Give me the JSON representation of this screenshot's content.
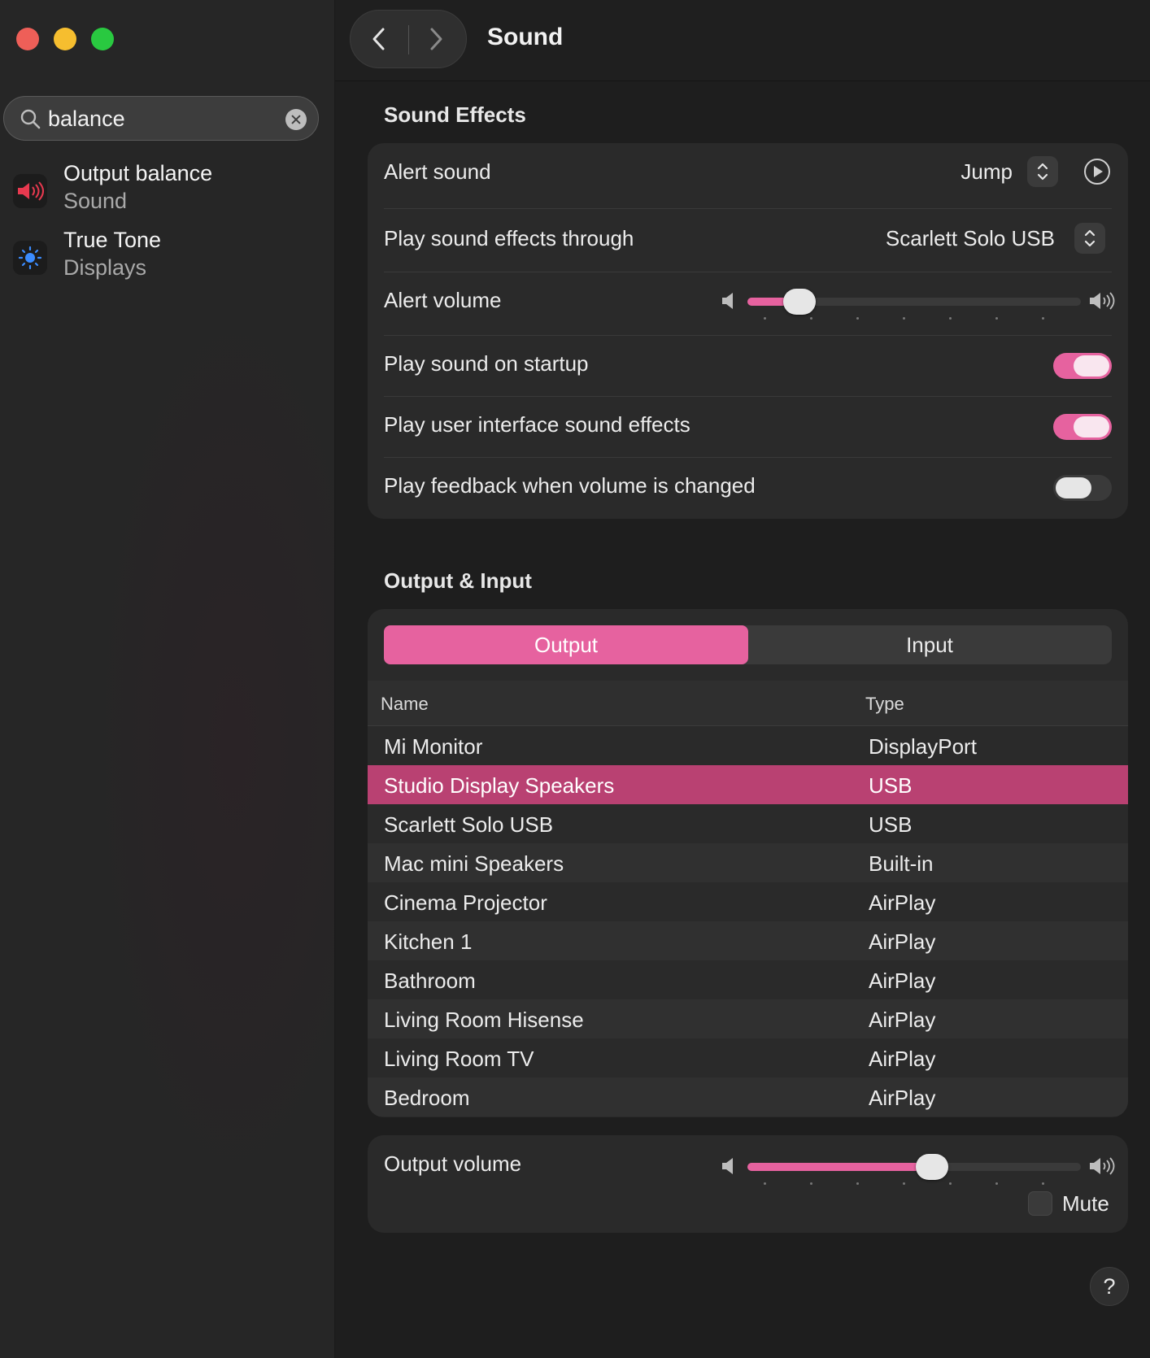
{
  "window": {
    "traffic_lights": {
      "close": "#ee5f58",
      "minimize": "#f6be2f",
      "zoom": "#29c940"
    }
  },
  "sidebar": {
    "search": {
      "value": "balance",
      "placeholder": "Search"
    },
    "results": [
      {
        "title": "Output balance",
        "subtitle": "Sound",
        "icon": "speaker-icon"
      },
      {
        "title": "True Tone",
        "subtitle": "Displays",
        "icon": "brightness-icon"
      }
    ]
  },
  "header": {
    "title": "Sound"
  },
  "sound_effects": {
    "heading": "Sound Effects",
    "alert_sound": {
      "label": "Alert sound",
      "value": "Jump"
    },
    "play_through": {
      "label": "Play sound effects through",
      "value": "Scarlett Solo USB"
    },
    "alert_volume": {
      "label": "Alert volume",
      "level": 0.12
    },
    "startup": {
      "label": "Play sound on startup",
      "on": true
    },
    "ui_sounds": {
      "label": "Play user interface sound effects",
      "on": true
    },
    "feedback": {
      "label": "Play feedback when volume is changed",
      "on": false
    }
  },
  "output_input": {
    "heading": "Output & Input",
    "tabs": [
      {
        "label": "Output",
        "active": true
      },
      {
        "label": "Input",
        "active": false
      }
    ],
    "columns": {
      "name": "Name",
      "type": "Type"
    },
    "devices": [
      {
        "name": "Mi Monitor",
        "type": "DisplayPort"
      },
      {
        "name": "Studio Display Speakers",
        "type": "USB",
        "selected": true
      },
      {
        "name": "Scarlett Solo USB",
        "type": "USB"
      },
      {
        "name": "Mac mini Speakers",
        "type": "Built-in"
      },
      {
        "name": "Cinema Projector",
        "type": "AirPlay"
      },
      {
        "name": "Kitchen 1",
        "type": "AirPlay"
      },
      {
        "name": "Bathroom",
        "type": "AirPlay"
      },
      {
        "name": "Living Room Hisense",
        "type": "AirPlay"
      },
      {
        "name": "Living Room TV",
        "type": "AirPlay"
      },
      {
        "name": "Bedroom",
        "type": "AirPlay"
      }
    ]
  },
  "output_volume": {
    "label": "Output volume",
    "level": 0.56,
    "mute_label": "Mute",
    "muted": false
  },
  "help": {
    "label": "?"
  },
  "colors": {
    "accent": "#e6629f",
    "selection": "#b94172"
  }
}
